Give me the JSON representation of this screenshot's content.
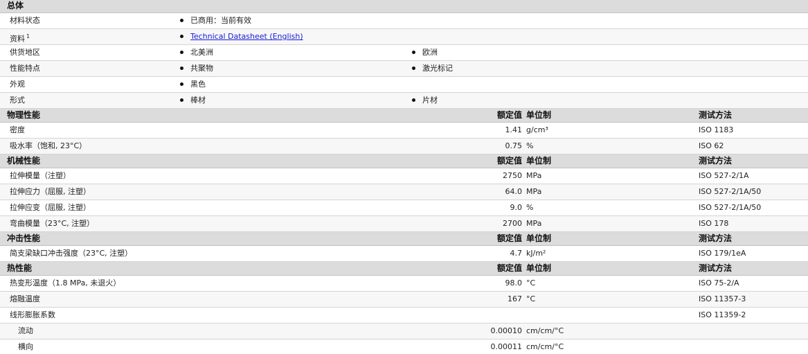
{
  "general": {
    "header": "总体",
    "status_label": "材料状态",
    "status_value": "已商用：当前有效",
    "docs_label": "资料",
    "docs_sup": "1",
    "docs_link": "Technical Datasheet (English)",
    "region_label": "供货地区",
    "region_1": "北美洲",
    "region_2": "欧洲",
    "features_label": "性能特点",
    "features_1": "共聚物",
    "features_2": "激光标记",
    "appearance_label": "外观",
    "appearance_1": "黑色",
    "form_label": "形式",
    "form_1": "棒材",
    "form_2": "片材"
  },
  "col_headers": {
    "value": "额定值",
    "unit": "单位制",
    "method": "测试方法"
  },
  "sections": [
    {
      "title": "物理性能",
      "rows": [
        {
          "label": "密度",
          "value": "1.41",
          "unit": "g/cm³",
          "method": "ISO 1183"
        },
        {
          "label": "吸水率（饱和, 23°C）",
          "value": "0.75",
          "unit": "%",
          "method": "ISO 62"
        }
      ]
    },
    {
      "title": "机械性能",
      "rows": [
        {
          "label": "拉伸模量（注塑）",
          "value": "2750",
          "unit": "MPa",
          "method": "ISO 527-2/1A"
        },
        {
          "label": "拉伸应力（屈服, 注塑）",
          "value": "64.0",
          "unit": "MPa",
          "method": "ISO 527-2/1A/50"
        },
        {
          "label": "拉伸应变（屈服, 注塑）",
          "value": "9.0",
          "unit": "%",
          "method": "ISO 527-2/1A/50"
        },
        {
          "label": "弯曲模量（23°C, 注塑）",
          "value": "2700",
          "unit": "MPa",
          "method": "ISO 178"
        }
      ]
    },
    {
      "title": "冲击性能",
      "rows": [
        {
          "label": "简支梁缺口冲击强度（23°C, 注塑）",
          "value": "4.7",
          "unit": "kJ/m²",
          "method": "ISO 179/1eA"
        }
      ]
    },
    {
      "title": "热性能",
      "rows": [
        {
          "label": "热变形温度（1.8 MPa, 未退火）",
          "value": "98.0",
          "unit": "°C",
          "method": "ISO 75-2/A"
        },
        {
          "label": "熔融温度",
          "value": "167",
          "unit": "°C",
          "method": "ISO 11357-3"
        },
        {
          "label": "线形膨胀系数",
          "value": "",
          "unit": "",
          "method": "ISO 11359-2"
        },
        {
          "label": "流动",
          "value": "0.00010",
          "unit": "cm/cm/°C",
          "method": "",
          "indent": true
        },
        {
          "label": "横向",
          "value": "0.00011",
          "unit": "cm/cm/°C",
          "method": "",
          "indent": true
        }
      ]
    }
  ]
}
